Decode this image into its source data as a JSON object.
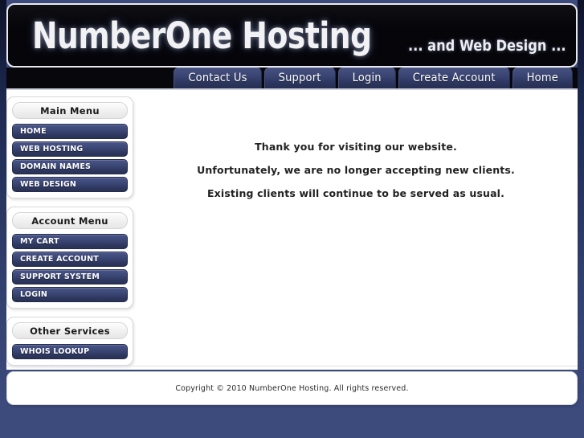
{
  "site": {
    "logo_text": "NumberOne Hosting",
    "tagline": "... and Web Design ...",
    "background_color": "#3c4a7c",
    "accent_color": "#3a4674",
    "header_bg": "#05050a"
  },
  "topnav": {
    "items": [
      {
        "label": "Contact Us"
      },
      {
        "label": "Support"
      },
      {
        "label": "Login"
      },
      {
        "label": "Create Account"
      },
      {
        "label": "Home"
      }
    ]
  },
  "sidebar": {
    "sections": [
      {
        "title": "Main Menu",
        "items": [
          {
            "label": "HOME"
          },
          {
            "label": "WEB HOSTING"
          },
          {
            "label": "DOMAIN NAMES"
          },
          {
            "label": "WEB DESIGN"
          }
        ]
      },
      {
        "title": "Account Menu",
        "items": [
          {
            "label": "MY CART"
          },
          {
            "label": "CREATE ACCOUNT"
          },
          {
            "label": "SUPPORT SYSTEM"
          },
          {
            "label": "LOGIN"
          }
        ]
      },
      {
        "title": "Other Services",
        "items": [
          {
            "label": "WHOIS LOOKUP"
          }
        ]
      }
    ]
  },
  "content": {
    "paragraphs": [
      "Thank you for visiting our website.",
      "Unfortunately, we are no longer accepting new clients.",
      "Existing clients will continue to be served as usual."
    ]
  },
  "footer": {
    "copyright": "Copyright © 2010 NumberOne Hosting. All rights reserved."
  }
}
